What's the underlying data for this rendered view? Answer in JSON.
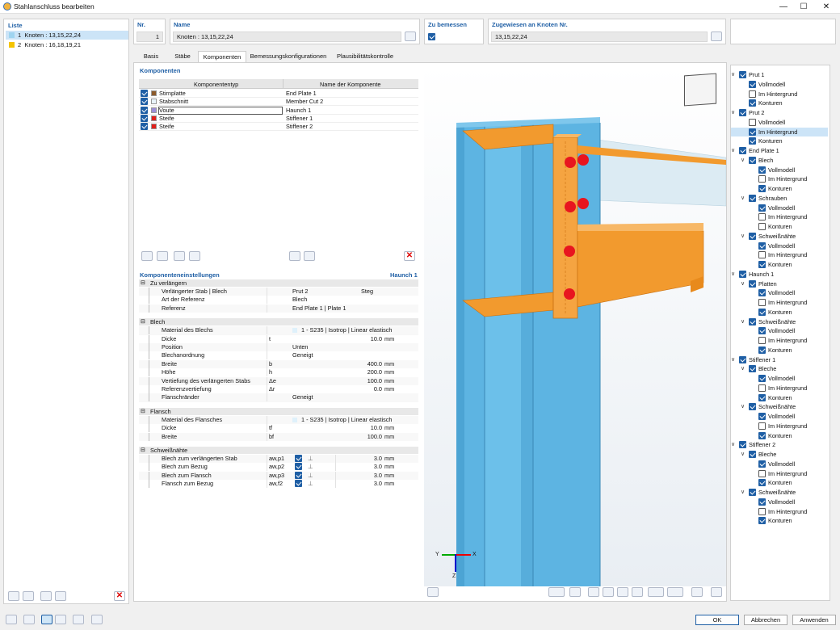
{
  "window": {
    "title": "Stahlanschluss bearbeiten"
  },
  "list": {
    "header": "Liste",
    "items": [
      {
        "num": "1",
        "label": "Knoten : 13,15,22,24",
        "color": "#9fd4f0"
      },
      {
        "num": "2",
        "label": "Knoten : 16,18,19,21",
        "color": "#f5c400"
      }
    ]
  },
  "top": {
    "nr_label": "Nr.",
    "nr_value": "1",
    "name_label": "Name",
    "name_value": "Knoten : 13,15,22,24",
    "design_label": "Zu bemessen",
    "assigned_label": "Zugewiesen an Knoten Nr.",
    "assigned_value": "13,15,22,24"
  },
  "tabs": [
    "Basis",
    "Stäbe",
    "Komponenten",
    "Bemessungskonfigurationen",
    "Plausibilitätskontrolle"
  ],
  "components": {
    "header": "Komponenten",
    "col_type": "Komponententyp",
    "col_name": "Name der Komponente",
    "rows": [
      {
        "type": "Stirnplatte",
        "name": "End Plate 1",
        "color": "#8b5a2b"
      },
      {
        "type": "Stabschnitt",
        "name": "Member Cut 2",
        "color": "#e8f4fb"
      },
      {
        "type": "Voute",
        "name": "Haunch 1",
        "color": "#9b8ed8"
      },
      {
        "type": "Steife",
        "name": "Stiffener 1",
        "color": "#e0201b"
      },
      {
        "type": "Steife",
        "name": "Stiffener 2",
        "color": "#e0201b"
      }
    ]
  },
  "settings": {
    "header": "Komponenteneinstellungen",
    "header_right": "Haunch 1",
    "groups": [
      {
        "title": "Zu verlängern",
        "rows": [
          {
            "label": "Verlängerter Stab | Blech",
            "sym": "",
            "value": "Prut 2",
            "value2": "Steg",
            "unit": ""
          },
          {
            "label": "Art der Referenz",
            "sym": "",
            "value": "Blech",
            "value2": "",
            "unit": ""
          },
          {
            "label": "Referenz",
            "sym": "",
            "value": "End Plate 1 | Plate 1",
            "value2": "",
            "unit": ""
          }
        ]
      },
      {
        "title": "Blech",
        "rows": [
          {
            "label": "Material des Blechs",
            "sym": "",
            "value": "1 - S235 | Isotrop | Linear elastisch",
            "value2": "",
            "unit": ""
          },
          {
            "label": "Dicke",
            "sym": "t",
            "value": "",
            "value2": "10.0",
            "unit": "mm"
          },
          {
            "label": "Position",
            "sym": "",
            "value": "Unten",
            "value2": "",
            "unit": ""
          },
          {
            "label": "Blechanordnung",
            "sym": "",
            "value": "Geneigt",
            "value2": "",
            "unit": ""
          },
          {
            "label": "Breite",
            "sym": "b",
            "value": "",
            "value2": "400.0",
            "unit": "mm"
          },
          {
            "label": "Höhe",
            "sym": "h",
            "value": "",
            "value2": "200.0",
            "unit": "mm"
          },
          {
            "label": "Vertiefung des verlängerten Stabs",
            "sym": "Δe",
            "value": "",
            "value2": "100.0",
            "unit": "mm"
          },
          {
            "label": "Referenzvertiefung",
            "sym": "Δr",
            "value": "",
            "value2": "0.0",
            "unit": "mm"
          },
          {
            "label": "Flanschränder",
            "sym": "",
            "value": "Geneigt",
            "value2": "",
            "unit": ""
          }
        ]
      },
      {
        "title": "Flansch",
        "rows": [
          {
            "label": "Material des Flansches",
            "sym": "",
            "value": "1 - S235 | Isotrop | Linear elastisch",
            "value2": "",
            "unit": ""
          },
          {
            "label": "Dicke",
            "sym": "tf",
            "value": "",
            "value2": "10.0",
            "unit": "mm"
          },
          {
            "label": "Breite",
            "sym": "bf",
            "value": "",
            "value2": "100.0",
            "unit": "mm"
          }
        ]
      },
      {
        "title": "Schweißnähte",
        "rows": [
          {
            "label": "Blech zum verlängerten Stab",
            "sym": "aw,p1",
            "value": "",
            "value2": "3.0",
            "unit": "mm"
          },
          {
            "label": "Blech zum Bezug",
            "sym": "aw,p2",
            "value": "",
            "value2": "3.0",
            "unit": "mm"
          },
          {
            "label": "Blech zum Flansch",
            "sym": "aw,p3",
            "value": "",
            "value2": "3.0",
            "unit": "mm"
          },
          {
            "label": "Flansch zum Bezug",
            "sym": "aw,f2",
            "value": "",
            "value2": "3.0",
            "unit": "mm"
          }
        ]
      }
    ]
  },
  "axes": {
    "x": "X",
    "y": "Y",
    "z": "Z"
  },
  "tree": [
    {
      "d": 0,
      "exp": "v",
      "cb": true,
      "label": "Prut 1"
    },
    {
      "d": 1,
      "exp": "",
      "cb": true,
      "label": "Vollmodell"
    },
    {
      "d": 1,
      "exp": "",
      "cb": false,
      "label": "Im Hintergrund"
    },
    {
      "d": 1,
      "exp": "",
      "cb": true,
      "label": "Konturen"
    },
    {
      "d": 0,
      "exp": "v",
      "cb": true,
      "label": "Prut 2"
    },
    {
      "d": 1,
      "exp": "",
      "cb": false,
      "label": "Vollmodell"
    },
    {
      "d": 1,
      "exp": "",
      "cb": true,
      "label": "Im Hintergrund",
      "sel": true
    },
    {
      "d": 1,
      "exp": "",
      "cb": true,
      "label": "Konturen"
    },
    {
      "d": 0,
      "exp": "v",
      "cb": true,
      "label": "End Plate 1"
    },
    {
      "d": 1,
      "exp": "v",
      "cb": true,
      "label": "Blech"
    },
    {
      "d": 2,
      "exp": "",
      "cb": true,
      "label": "Vollmodell"
    },
    {
      "d": 2,
      "exp": "",
      "cb": false,
      "label": "Im Hintergrund"
    },
    {
      "d": 2,
      "exp": "",
      "cb": true,
      "label": "Konturen"
    },
    {
      "d": 1,
      "exp": "v",
      "cb": true,
      "label": "Schrauben"
    },
    {
      "d": 2,
      "exp": "",
      "cb": true,
      "label": "Vollmodell"
    },
    {
      "d": 2,
      "exp": "",
      "cb": false,
      "label": "Im Hintergrund"
    },
    {
      "d": 2,
      "exp": "",
      "cb": false,
      "label": "Konturen"
    },
    {
      "d": 1,
      "exp": "v",
      "cb": true,
      "label": "Schweißnähte"
    },
    {
      "d": 2,
      "exp": "",
      "cb": true,
      "label": "Vollmodell"
    },
    {
      "d": 2,
      "exp": "",
      "cb": false,
      "label": "Im Hintergrund"
    },
    {
      "d": 2,
      "exp": "",
      "cb": true,
      "label": "Konturen"
    },
    {
      "d": 0,
      "exp": "v",
      "cb": true,
      "label": "Haunch 1"
    },
    {
      "d": 1,
      "exp": "v",
      "cb": true,
      "label": "Platten"
    },
    {
      "d": 2,
      "exp": "",
      "cb": true,
      "label": "Vollmodell"
    },
    {
      "d": 2,
      "exp": "",
      "cb": false,
      "label": "Im Hintergrund"
    },
    {
      "d": 2,
      "exp": "",
      "cb": true,
      "label": "Konturen"
    },
    {
      "d": 1,
      "exp": "v",
      "cb": true,
      "label": "Schweißnähte"
    },
    {
      "d": 2,
      "exp": "",
      "cb": true,
      "label": "Vollmodell"
    },
    {
      "d": 2,
      "exp": "",
      "cb": false,
      "label": "Im Hintergrund"
    },
    {
      "d": 2,
      "exp": "",
      "cb": true,
      "label": "Konturen"
    },
    {
      "d": 0,
      "exp": "v",
      "cb": true,
      "label": "Stiffener 1"
    },
    {
      "d": 1,
      "exp": "v",
      "cb": true,
      "label": "Bleche"
    },
    {
      "d": 2,
      "exp": "",
      "cb": true,
      "label": "Vollmodell"
    },
    {
      "d": 2,
      "exp": "",
      "cb": false,
      "label": "Im Hintergrund"
    },
    {
      "d": 2,
      "exp": "",
      "cb": true,
      "label": "Konturen"
    },
    {
      "d": 1,
      "exp": "v",
      "cb": true,
      "label": "Schweißnähte"
    },
    {
      "d": 2,
      "exp": "",
      "cb": true,
      "label": "Vollmodell"
    },
    {
      "d": 2,
      "exp": "",
      "cb": false,
      "label": "Im Hintergrund"
    },
    {
      "d": 2,
      "exp": "",
      "cb": true,
      "label": "Konturen"
    },
    {
      "d": 0,
      "exp": "v",
      "cb": true,
      "label": "Stiffener 2"
    },
    {
      "d": 1,
      "exp": "v",
      "cb": true,
      "label": "Bleche"
    },
    {
      "d": 2,
      "exp": "",
      "cb": true,
      "label": "Vollmodell"
    },
    {
      "d": 2,
      "exp": "",
      "cb": false,
      "label": "Im Hintergrund"
    },
    {
      "d": 2,
      "exp": "",
      "cb": true,
      "label": "Konturen"
    },
    {
      "d": 1,
      "exp": "v",
      "cb": true,
      "label": "Schweißnähte"
    },
    {
      "d": 2,
      "exp": "",
      "cb": true,
      "label": "Vollmodell"
    },
    {
      "d": 2,
      "exp": "",
      "cb": false,
      "label": "Im Hintergrund"
    },
    {
      "d": 2,
      "exp": "",
      "cb": true,
      "label": "Konturen"
    }
  ],
  "buttons": {
    "ok": "OK",
    "cancel": "Abbrechen",
    "apply": "Anwenden"
  },
  "colors": {
    "accent": "#1f5fa5",
    "steel": "#5db4e2",
    "plate": "#f29a2e",
    "bolt": "#e8151f"
  }
}
